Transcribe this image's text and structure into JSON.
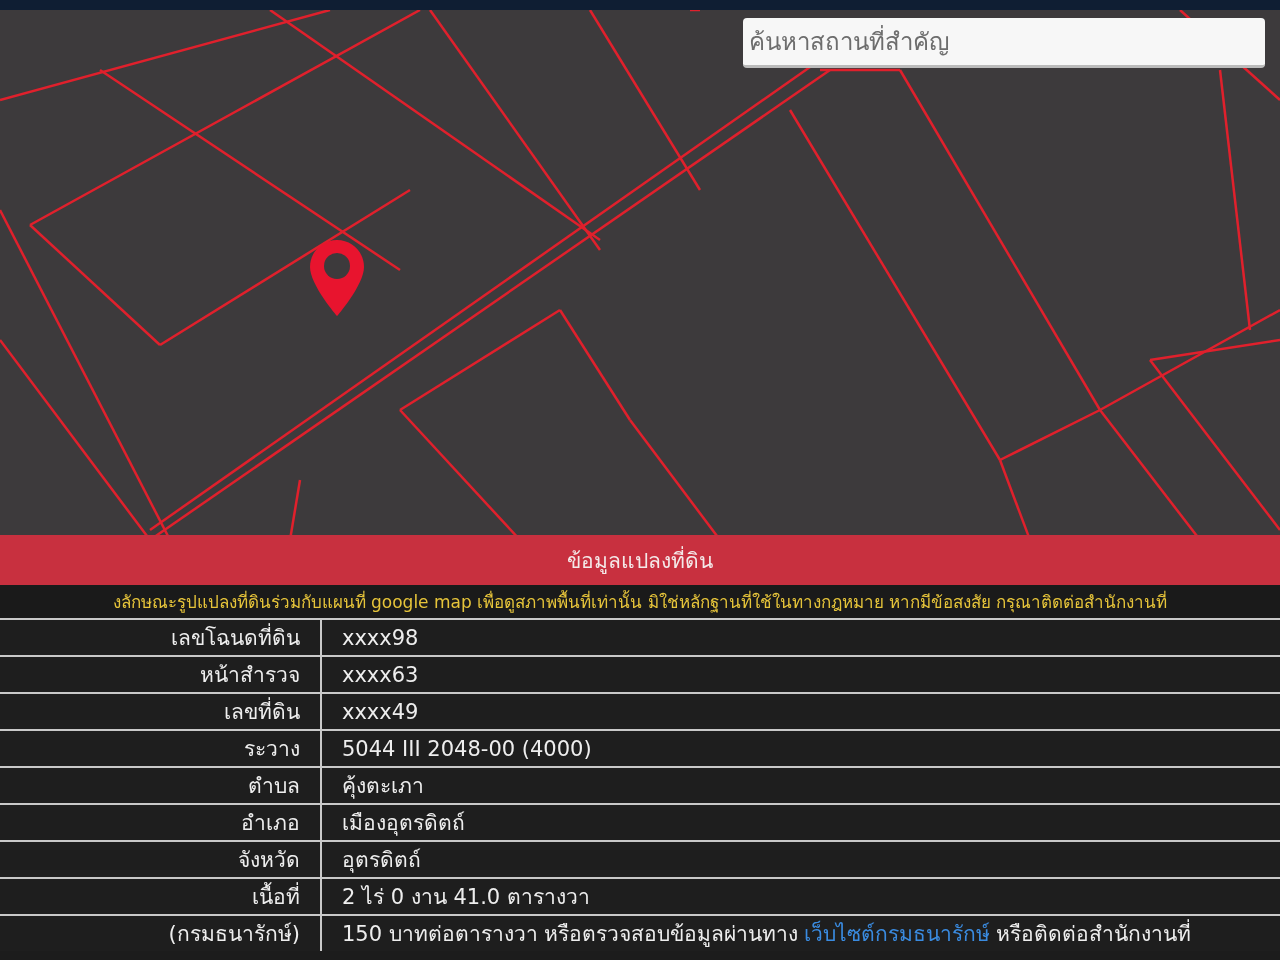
{
  "search": {
    "placeholder": "ค้นหาสถานที่สำคัญ"
  },
  "panel": {
    "title": "ข้อมูลแปลงที่ดิน",
    "disclaimer": "งลักษณะรูปแปลงที่ดินร่วมกับแผนที่ google map เพื่อดูสภาพพื้นที่เท่านั้น มิใช่หลักฐานที่ใช้ในทางกฎหมาย หากมีข้อสงสัย กรุณาติดต่อสำนักงานที่"
  },
  "rows": [
    {
      "label": "เลขโฉนดที่ดิน",
      "value": "xxxx98"
    },
    {
      "label": "หน้าสำรวจ",
      "value": "xxxx63"
    },
    {
      "label": "เลขที่ดิน",
      "value": "xxxx49"
    },
    {
      "label": "ระวาง",
      "value": "5044 III 2048-00 (4000)"
    },
    {
      "label": "ตำบล",
      "value": "คุ้งตะเภา"
    },
    {
      "label": "อำเภอ",
      "value": "เมืองอุตรดิตถ์"
    },
    {
      "label": "จังหวัด",
      "value": "อุตรดิตถ์"
    },
    {
      "label": "เนื้อที่",
      "value": "2 ไร่ 0 งาน 41.0 ตารางวา"
    },
    {
      "label": "(กรมธนารักษ์)",
      "value": "150 บาทต่อตารางวา หรือตรวจสอบข้อมูลผ่านทาง",
      "link": "เว็บไซต์กรมธนารักษ์",
      "value_after": "หรือติดต่อสำนักงานที่"
    }
  ]
}
